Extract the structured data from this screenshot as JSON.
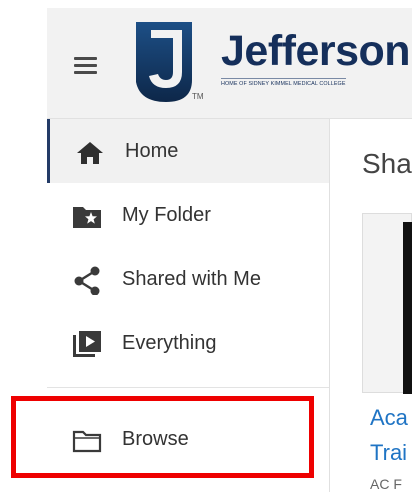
{
  "header": {
    "brand_name": "Jefferson",
    "brand_tagline": "HOME OF SIDNEY KIMMEL MEDICAL COLLEGE",
    "trademark": "TM",
    "menu_icon": "hamburger-menu-icon",
    "logo_icon": "jefferson-j-shield-logo"
  },
  "sidebar": {
    "items": [
      {
        "label": "Home",
        "icon": "home-icon",
        "active": true
      },
      {
        "label": "My Folder",
        "icon": "starred-folder-icon",
        "active": false
      },
      {
        "label": "Shared with Me",
        "icon": "share-icon",
        "active": false
      },
      {
        "label": "Everything",
        "icon": "video-library-icon",
        "active": false
      },
      {
        "label": "Browse",
        "icon": "folder-outline-icon",
        "active": false,
        "highlighted": true
      }
    ]
  },
  "main": {
    "title": "Sha",
    "card": {
      "line1": "Aca",
      "line2": "Trai",
      "line3": "AC F"
    }
  },
  "colors": {
    "brand_navy": "#152f5b",
    "highlight_red": "#ee0000",
    "link_blue": "#1f74c4",
    "active_bg": "#f1f1f1"
  }
}
